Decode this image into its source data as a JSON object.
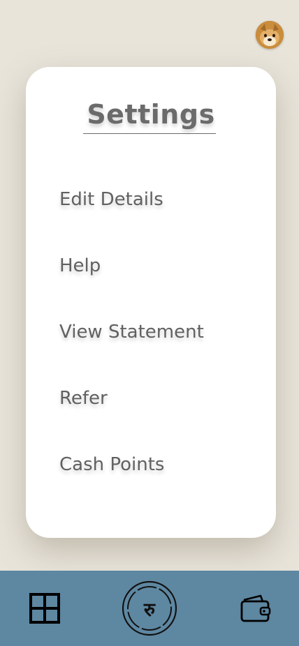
{
  "settings": {
    "title": "Settings",
    "items": [
      {
        "label": "Edit Details"
      },
      {
        "label": "Help"
      },
      {
        "label": "View Statement"
      },
      {
        "label": "Refer"
      },
      {
        "label": "Cash Points"
      }
    ]
  },
  "bottom_nav": {
    "left_icon": "dashboard-grid-icon",
    "center_icon": "rupee-coin-icon",
    "center_label": "रु",
    "right_icon": "wallet-icon"
  },
  "header": {
    "avatar_icon": "dog-avatar"
  },
  "colors": {
    "background": "#e8e4da",
    "card": "#ffffff",
    "text": "#616161",
    "nav": "#5e87a1"
  }
}
